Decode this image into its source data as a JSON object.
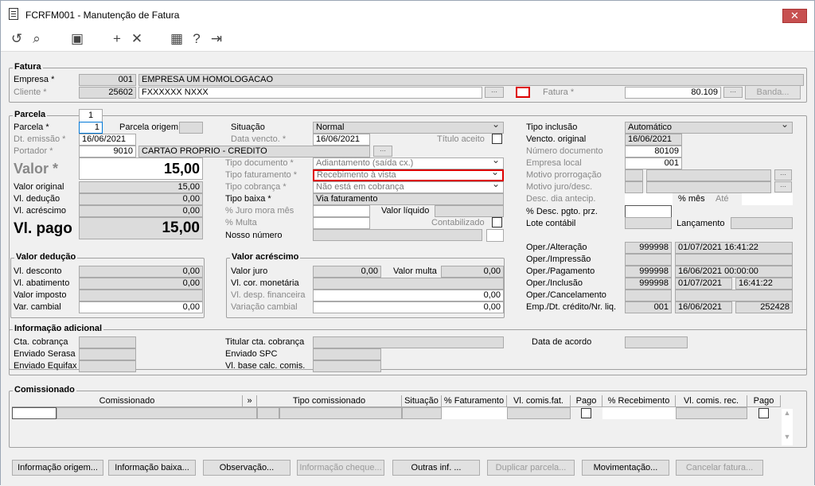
{
  "window": {
    "title": "FCRFM001 - Manutenção de Fatura",
    "close": "✕"
  },
  "fatura": {
    "title": "Fatura",
    "empresa_label": "Empresa *",
    "empresa_code": "001",
    "empresa_name": "EMPRESA UM HOMOLOGACAO",
    "cliente_label": "Cliente *",
    "cliente_code": "25602",
    "cliente_name": "FXXXXXX NXXX",
    "fatura_label": "Fatura *",
    "fatura_value": "80.109",
    "banda_label": "Banda..."
  },
  "parcela": {
    "title": "Parcela",
    "tab": "1",
    "parcela_label": "Parcela *",
    "parcela_value": "1",
    "parcela_origem_label": "Parcela origem",
    "dt_emissao_label": "Dt. emissão *",
    "dt_emissao": "16/06/2021",
    "portador_label": "Portador *",
    "portador_code": "9010",
    "portador_name": "CARTAO PROPRIO - CREDITO",
    "valor_label": "Valor *",
    "valor": "15,00",
    "valor_original_label": "Valor original",
    "valor_original": "15,00",
    "vl_deducao_label": "Vl. dedução",
    "vl_deducao": "0,00",
    "vl_acrescimo_label": "Vl. acréscimo",
    "vl_acrescimo": "0,00",
    "vl_pago_label": "Vl. pago",
    "vl_pago": "15,00",
    "situacao_label": "Situação",
    "situacao": "Normal",
    "data_vencto_label": "Data vencto. *",
    "data_vencto": "16/06/2021",
    "titulo_aceito_label": "Título aceito",
    "tipo_documento_label": "Tipo documento *",
    "tipo_documento": "Adiantamento (saída cx.)",
    "tipo_faturamento_label": "Tipo faturamento *",
    "tipo_faturamento": "Recebimento à vista",
    "tipo_cobranca_label": "Tipo cobrança *",
    "tipo_cobranca": "Não está em cobrança",
    "tipo_baixa_label": "Tipo baixa *",
    "tipo_baixa": "Via faturamento",
    "juro_mora_label": "% Juro mora mês",
    "valor_liquido_label": "Valor líquido",
    "multa_label": "% Multa",
    "contabilizado_label": "Contabilizado",
    "nosso_numero_label": "Nosso número",
    "tipo_inclusao_label": "Tipo inclusão",
    "tipo_inclusao": "Automático",
    "vencto_original_label": "Vencto. original",
    "vencto_original": "16/06/2021",
    "numero_documento_label": "Número documento",
    "numero_documento": "80109",
    "empresa_local_label": "Empresa local",
    "empresa_local": "001",
    "motivo_prorrogacao_label": "Motivo prorrogação",
    "motivo_juro_label": "Motivo juro/desc.",
    "desc_dia_label": "Desc. dia antecip.",
    "pct_mes_label": "% mês",
    "ate_label": "Até",
    "desc_pgto_label": "% Desc. pgto. prz.",
    "lote_contabil_label": "Lote contábil",
    "lancamento_label": "Lançamento"
  },
  "valor_deducao": {
    "title": "Valor dedução",
    "vl_desconto_label": "Vl. desconto",
    "vl_desconto": "0,00",
    "vl_abatimento_label": "Vl. abatimento",
    "vl_abatimento": "0,00",
    "valor_imposto_label": "Valor imposto",
    "var_cambial_label": "Var. cambial",
    "var_cambial": "0,00"
  },
  "valor_acrescimo": {
    "title": "Valor acréscimo",
    "valor_juro_label": "Valor juro",
    "valor_juro": "0,00",
    "valor_multa_label": "Valor multa",
    "valor_multa": "0,00",
    "cor_monetaria_label": "Vl. cor. monetária",
    "desp_financeira_label": "Vl. desp. financeira",
    "desp_financeira": "0,00",
    "variacao_cambial_label": "Variação cambial",
    "variacao_cambial": "0,00"
  },
  "operacoes": {
    "alteracao_label": "Oper./Alteração",
    "alteracao_user": "999998",
    "alteracao_date": "01/07/2021 16:41:22",
    "impressao_label": "Oper./Impressão",
    "pagamento_label": "Oper./Pagamento",
    "pagamento_user": "999998",
    "pagamento_date": "16/06/2021 00:00:00",
    "inclusao_label": "Oper./Inclusão",
    "inclusao_user": "999998",
    "inclusao_date": "01/07/2021",
    "inclusao_time": "16:41:22",
    "cancelamento_label": "Oper./Cancelamento",
    "emp_label": "Emp./Dt. crédito/Nr. liq.",
    "emp_code": "001",
    "emp_date": "16/06/2021",
    "emp_nr": "252428"
  },
  "info": {
    "title": "Informação adicional",
    "cta_cobranca_label": "Cta. cobrança",
    "enviado_serasa_label": "Enviado Serasa",
    "enviado_equifax_label": "Enviado Equifax",
    "titular_label": "Titular cta. cobrança",
    "enviado_spc_label": "Enviado SPC",
    "vl_base_label": "Vl. base calc. comis.",
    "data_acordo_label": "Data de acordo"
  },
  "comissionado": {
    "title": "Comissionado",
    "headers": [
      "Comissionado",
      "»",
      "Tipo comissionado",
      "Situação",
      "% Faturamento",
      "Vl. comis.fat.",
      "Pago",
      "% Recebimento",
      "Vl. comis. rec.",
      "Pago"
    ]
  },
  "buttons": [
    "Informação origem...",
    "Informação baixa...",
    "Observação...",
    "Informação cheque...",
    "Outras inf. ...",
    "Duplicar parcela...",
    "Movimentação...",
    "Cancelar fatura..."
  ]
}
